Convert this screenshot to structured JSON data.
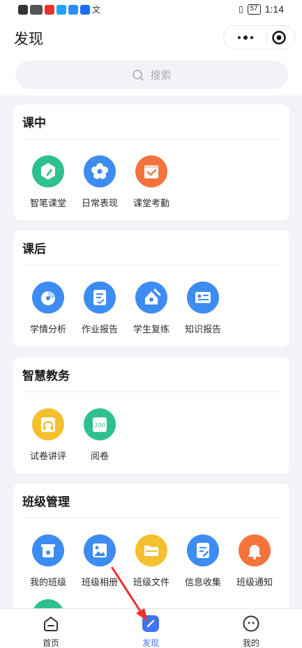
{
  "status_bar": {
    "time": "1:14",
    "battery": "57"
  },
  "header": {
    "title": "发现"
  },
  "search": {
    "placeholder": "搜索"
  },
  "sections": {
    "in_class": {
      "title": "课中",
      "items": [
        {
          "label": "智笔课堂",
          "icon": "pen-icon",
          "color": "#2fc08e"
        },
        {
          "label": "日常表现",
          "icon": "flower-icon",
          "color": "#3d8cf2"
        },
        {
          "label": "课堂考勤",
          "icon": "checkin-icon",
          "color": "#f4733c"
        }
      ]
    },
    "after_class": {
      "title": "课后",
      "items": [
        {
          "label": "学情分析",
          "icon": "pie-chart-icon",
          "color": "#3d8cf2"
        },
        {
          "label": "作业报告",
          "icon": "report-icon",
          "color": "#3d8cf2"
        },
        {
          "label": "学生复练",
          "icon": "home-review-icon",
          "color": "#3d8cf2"
        },
        {
          "label": "知识报告",
          "icon": "knowledge-card-icon",
          "color": "#3d8cf2"
        }
      ]
    },
    "smart_edu": {
      "title": "智慧教务",
      "items": [
        {
          "label": "试卷讲评",
          "icon": "headphone-paper-icon",
          "color": "#f5c02e"
        },
        {
          "label": "阅卷",
          "icon": "score-100-icon",
          "color": "#2fc08e"
        }
      ]
    },
    "class_mgmt": {
      "title": "班级管理",
      "items": [
        {
          "label": "我的班级",
          "icon": "classroom-icon",
          "color": "#3d8cf2"
        },
        {
          "label": "班级相册",
          "icon": "album-icon",
          "color": "#3d8cf2"
        },
        {
          "label": "班级文件",
          "icon": "folder-icon",
          "color": "#f5c02e"
        },
        {
          "label": "信息收集",
          "icon": "form-edit-icon",
          "color": "#3d8cf2"
        },
        {
          "label": "班级通知",
          "icon": "bell-icon",
          "color": "#f4733c"
        }
      ]
    }
  },
  "tabbar": {
    "items": [
      {
        "label": "首页",
        "icon": "home-icon"
      },
      {
        "label": "发现",
        "icon": "discover-pen-icon",
        "active": true
      },
      {
        "label": "我的",
        "icon": "profile-face-icon"
      }
    ]
  },
  "colors": {
    "accent": "#3e73f3",
    "annotation_arrow": "#e8322f"
  }
}
